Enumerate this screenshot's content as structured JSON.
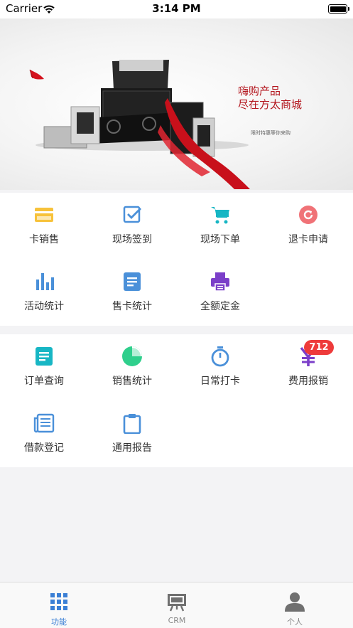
{
  "status_bar": {
    "carrier": "Carrier",
    "time": "3:14 PM"
  },
  "banner": {
    "headline": "嗨购产品\n尽在方太商城",
    "subtitle": "限时特惠等你来购"
  },
  "sections": [
    {
      "items": [
        {
          "label": "卡销售",
          "icon": "card-icon",
          "color": "#f7c23a"
        },
        {
          "label": "现场签到",
          "icon": "checkbox-icon",
          "color": "#4a90d9"
        },
        {
          "label": "现场下单",
          "icon": "cart-icon",
          "color": "#17b6c4"
        },
        {
          "label": "退卡申请",
          "icon": "refresh-circle-icon",
          "color": "#f07277"
        },
        {
          "label": "活动统计",
          "icon": "bar-chart-icon",
          "color": "#4a90d9"
        },
        {
          "label": "售卡统计",
          "icon": "document-icon",
          "color": "#4a90d9"
        },
        {
          "label": "全额定金",
          "icon": "printer-icon",
          "color": "#7b3fc9"
        }
      ]
    },
    {
      "items": [
        {
          "label": "订单查询",
          "icon": "document-icon",
          "color": "#17b6c4"
        },
        {
          "label": "销售统计",
          "icon": "pie-chart-icon",
          "color": "#2fcf8c"
        },
        {
          "label": "日常打卡",
          "icon": "stopwatch-icon",
          "color": "#4a90d9"
        },
        {
          "label": "费用报销",
          "icon": "yuan-icon",
          "color": "#7b3fc9",
          "badge": "712"
        },
        {
          "label": "借款登记",
          "icon": "newspaper-icon",
          "color": "#4a90d9"
        },
        {
          "label": "通用报告",
          "icon": "clipboard-icon",
          "color": "#4a90d9"
        }
      ]
    }
  ],
  "tab_bar": {
    "active_color": "#3a7fd5",
    "tabs": [
      {
        "label": "功能",
        "icon": "grid-icon",
        "active": true
      },
      {
        "label": "CRM",
        "icon": "easel-icon",
        "active": false
      },
      {
        "label": "个人",
        "icon": "person-icon",
        "active": false
      }
    ]
  }
}
